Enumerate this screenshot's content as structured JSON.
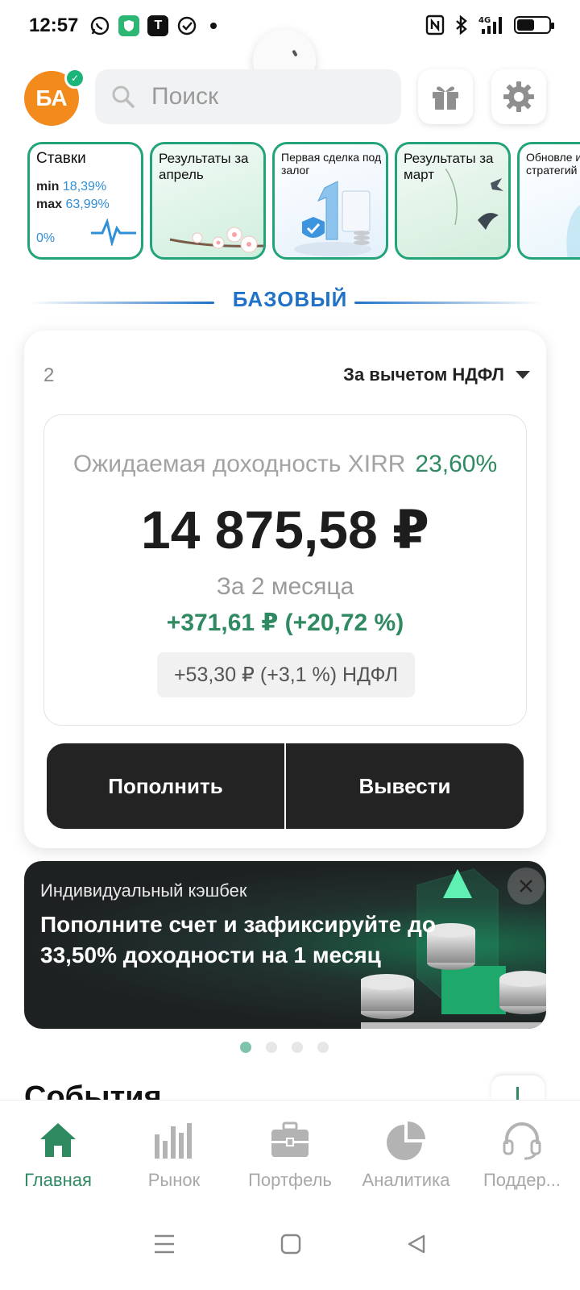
{
  "status_bar": {
    "time": "12:57"
  },
  "header": {
    "avatar_initials": "БА",
    "search_placeholder": "Поиск"
  },
  "stories": [
    {
      "title": "Ставки",
      "min_label": "min",
      "min_value": "18,39%",
      "max_label": "max",
      "max_value": "63,99%",
      "zero": "0%"
    },
    {
      "title": "Результаты за апрель"
    },
    {
      "title": "Первая сделка под залог"
    },
    {
      "title": "Результаты за март"
    },
    {
      "title": "Обновле инвести стратегий"
    }
  ],
  "section": {
    "title": "БАЗОВЫЙ"
  },
  "card": {
    "account_number": "2",
    "tax_mode": "За вычетом НДФЛ",
    "xirr_label": "Ожидаемая доходность XIRR",
    "xirr_value": "23,60%",
    "amount": "14 875,58 ₽",
    "period": "За 2 месяца",
    "profit": "+371,61 ₽ (+20,72 %)",
    "tax_chip": "+53,30 ₽ (+3,1 %) НДФЛ",
    "deposit_label": "Пополнить",
    "withdraw_label": "Вывести"
  },
  "promo": {
    "label": "Индивидуальный кэшбек",
    "text": "Пополните счет и зафиксируйте до 33,50% доходности на 1 месяц"
  },
  "carousel": {
    "total_dots": 4,
    "active_index": 0
  },
  "events": {
    "title": "События"
  },
  "bottom_nav": [
    {
      "label": "Главная",
      "icon": "home-icon",
      "active": true
    },
    {
      "label": "Рынок",
      "icon": "market-bars-icon",
      "active": false
    },
    {
      "label": "Портфель",
      "icon": "briefcase-icon",
      "active": false
    },
    {
      "label": "Аналитика",
      "icon": "pie-chart-icon",
      "active": false
    },
    {
      "label": "Поддер...",
      "icon": "headset-icon",
      "active": false
    }
  ],
  "colors": {
    "accent": "#2f8a62",
    "brand_blue": "#1f72c7",
    "dark_button": "#232323",
    "avatar": "#f28a1c"
  }
}
